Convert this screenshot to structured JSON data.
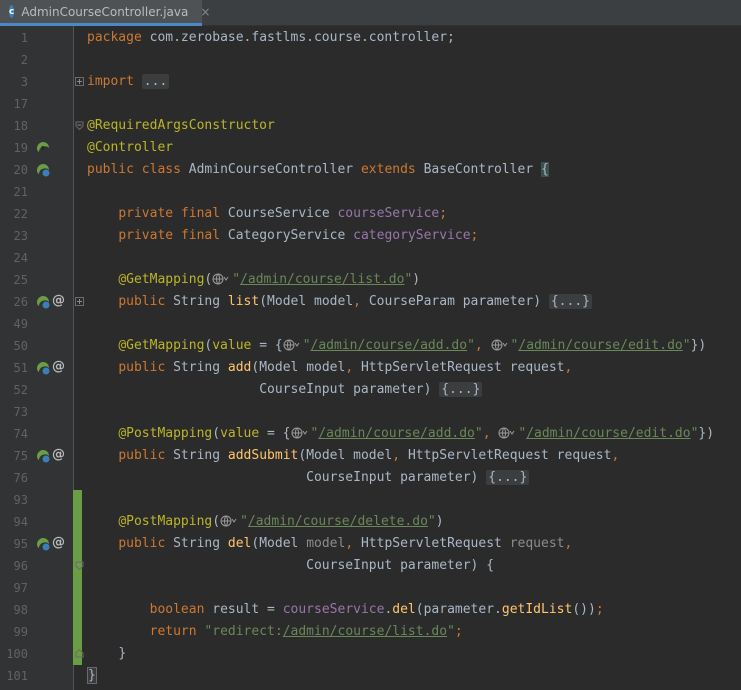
{
  "tab": {
    "title": "AdminCourseController.java",
    "close": "×",
    "file_type_icon": "class-c-icon",
    "icon_letter": "c"
  },
  "colors": {
    "keyword": "#cc7832",
    "annotation": "#bbb529",
    "string": "#6a8759",
    "field": "#9876aa",
    "method": "#ffc66d",
    "text": "#a9b7c6",
    "change_marker": "#6a9e45",
    "background": "#2b2b2b",
    "gutter": "#313335"
  },
  "lines": [
    {
      "num": "1",
      "text": "package com.zerobase.fastlms.course.controller;"
    },
    {
      "num": "2",
      "text": ""
    },
    {
      "num": "3",
      "text": "import ..."
    },
    {
      "num": "17",
      "text": ""
    },
    {
      "num": "18",
      "text": "@RequiredArgsConstructor"
    },
    {
      "num": "19",
      "text": "@Controller"
    },
    {
      "num": "20",
      "text": "public class AdminCourseController extends BaseController {"
    },
    {
      "num": "21",
      "text": ""
    },
    {
      "num": "22",
      "text": "    private final CourseService courseService;"
    },
    {
      "num": "23",
      "text": "    private final CategoryService categoryService;"
    },
    {
      "num": "24",
      "text": ""
    },
    {
      "num": "25",
      "text": "    @GetMapping(\"/admin/course/list.do\")"
    },
    {
      "num": "26",
      "text": "    public String list(Model model, CourseParam parameter) {...}"
    },
    {
      "num": "49",
      "text": ""
    },
    {
      "num": "50",
      "text": "    @GetMapping(value = {\"/admin/course/add.do\", \"/admin/course/edit.do\"})"
    },
    {
      "num": "51",
      "text": "    public String add(Model model, HttpServletRequest request,"
    },
    {
      "num": "52",
      "text": "                      CourseInput parameter) {...}"
    },
    {
      "num": "73",
      "text": ""
    },
    {
      "num": "74",
      "text": "    @PostMapping(value = {\"/admin/course/add.do\", \"/admin/course/edit.do\"})"
    },
    {
      "num": "75",
      "text": "    public String addSubmit(Model model, HttpServletRequest request,"
    },
    {
      "num": "76",
      "text": "                            CourseInput parameter) {...}"
    },
    {
      "num": "93",
      "text": ""
    },
    {
      "num": "94",
      "text": "    @PostMapping(\"/admin/course/delete.do\")"
    },
    {
      "num": "95",
      "text": "    public String del(Model model, HttpServletRequest request,"
    },
    {
      "num": "96",
      "text": "                            CourseInput parameter) {"
    },
    {
      "num": "97",
      "text": ""
    },
    {
      "num": "98",
      "text": "        boolean result = courseService.del(parameter.getIdList());"
    },
    {
      "num": "99",
      "text": "        return \"redirect:/admin/course/list.do\";"
    },
    {
      "num": "100",
      "text": "    }"
    },
    {
      "num": "101",
      "text": "}"
    }
  ],
  "tokens": {
    "package": "package",
    "package_name": " com.zerobase.fastlms.course.controller;",
    "import": "import",
    "import_fold": "...",
    "ann_required": "@RequiredArgsConstructor",
    "ann_controller": "@Controller",
    "public": "public",
    "class": "class",
    "class_name": "AdminCourseController",
    "extends": "extends",
    "base": "BaseController",
    "open_brace": "{",
    "private": "private",
    "final": "final",
    "course_service_type": "CourseService",
    "course_service_field": "courseService",
    "category_service_type": "CategoryService",
    "category_service_field": "categoryService",
    "get_mapping": "@GetMapping",
    "post_mapping": "@PostMapping",
    "url_list": "/admin/course/list.do",
    "url_add": "/admin/course/add.do",
    "url_edit": "/admin/course/edit.do",
    "url_delete": "/admin/course/delete.do",
    "value": "value",
    "string_type": "String",
    "m_list": "list",
    "m_add": "add",
    "m_add_submit": "addSubmit",
    "m_del": "del",
    "model_type": "Model",
    "model_param": "model",
    "course_param_type": "CourseParam",
    "parameter": "parameter",
    "http_type": "HttpServletRequest",
    "request": "request",
    "course_input_type": "CourseInput",
    "method_fold": "{...}",
    "boolean": "boolean",
    "result": "result",
    "del_call": "del",
    "get_id_list": "getIdList",
    "return": "return",
    "redirect_prefix": "redirect:",
    "close_brace": "}"
  },
  "gutter_icons": {
    "controller": "spring-bean-icon",
    "mapping": "web-endpoint-icon",
    "at": "@"
  }
}
